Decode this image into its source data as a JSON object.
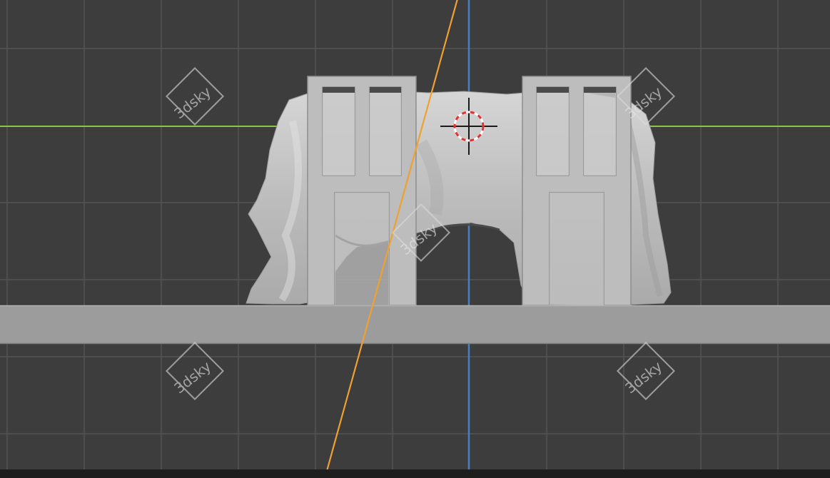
{
  "app": {
    "view": "3D viewport (orthographic side view)"
  },
  "viewport": {
    "background_color": "#3d3d3d",
    "grid_color": "#555555",
    "axis_x_color": "#8cc63f",
    "axis_z_color": "#4a7fbf",
    "object_origin_line_color": "#f0a030"
  },
  "scene_object": {
    "name": "draped-cloth-on-frames",
    "color_base": "#c8c8c8",
    "platform_color": "#9c9c9c"
  },
  "cursor_3d": {
    "ring_colors": [
      "#e63030",
      "#ffffff"
    ]
  },
  "watermarks": [
    {
      "text": "3dsky"
    },
    {
      "text": "3dsky"
    },
    {
      "text": "3dsky"
    },
    {
      "text": "3dsky"
    },
    {
      "text": "3dsky"
    }
  ]
}
